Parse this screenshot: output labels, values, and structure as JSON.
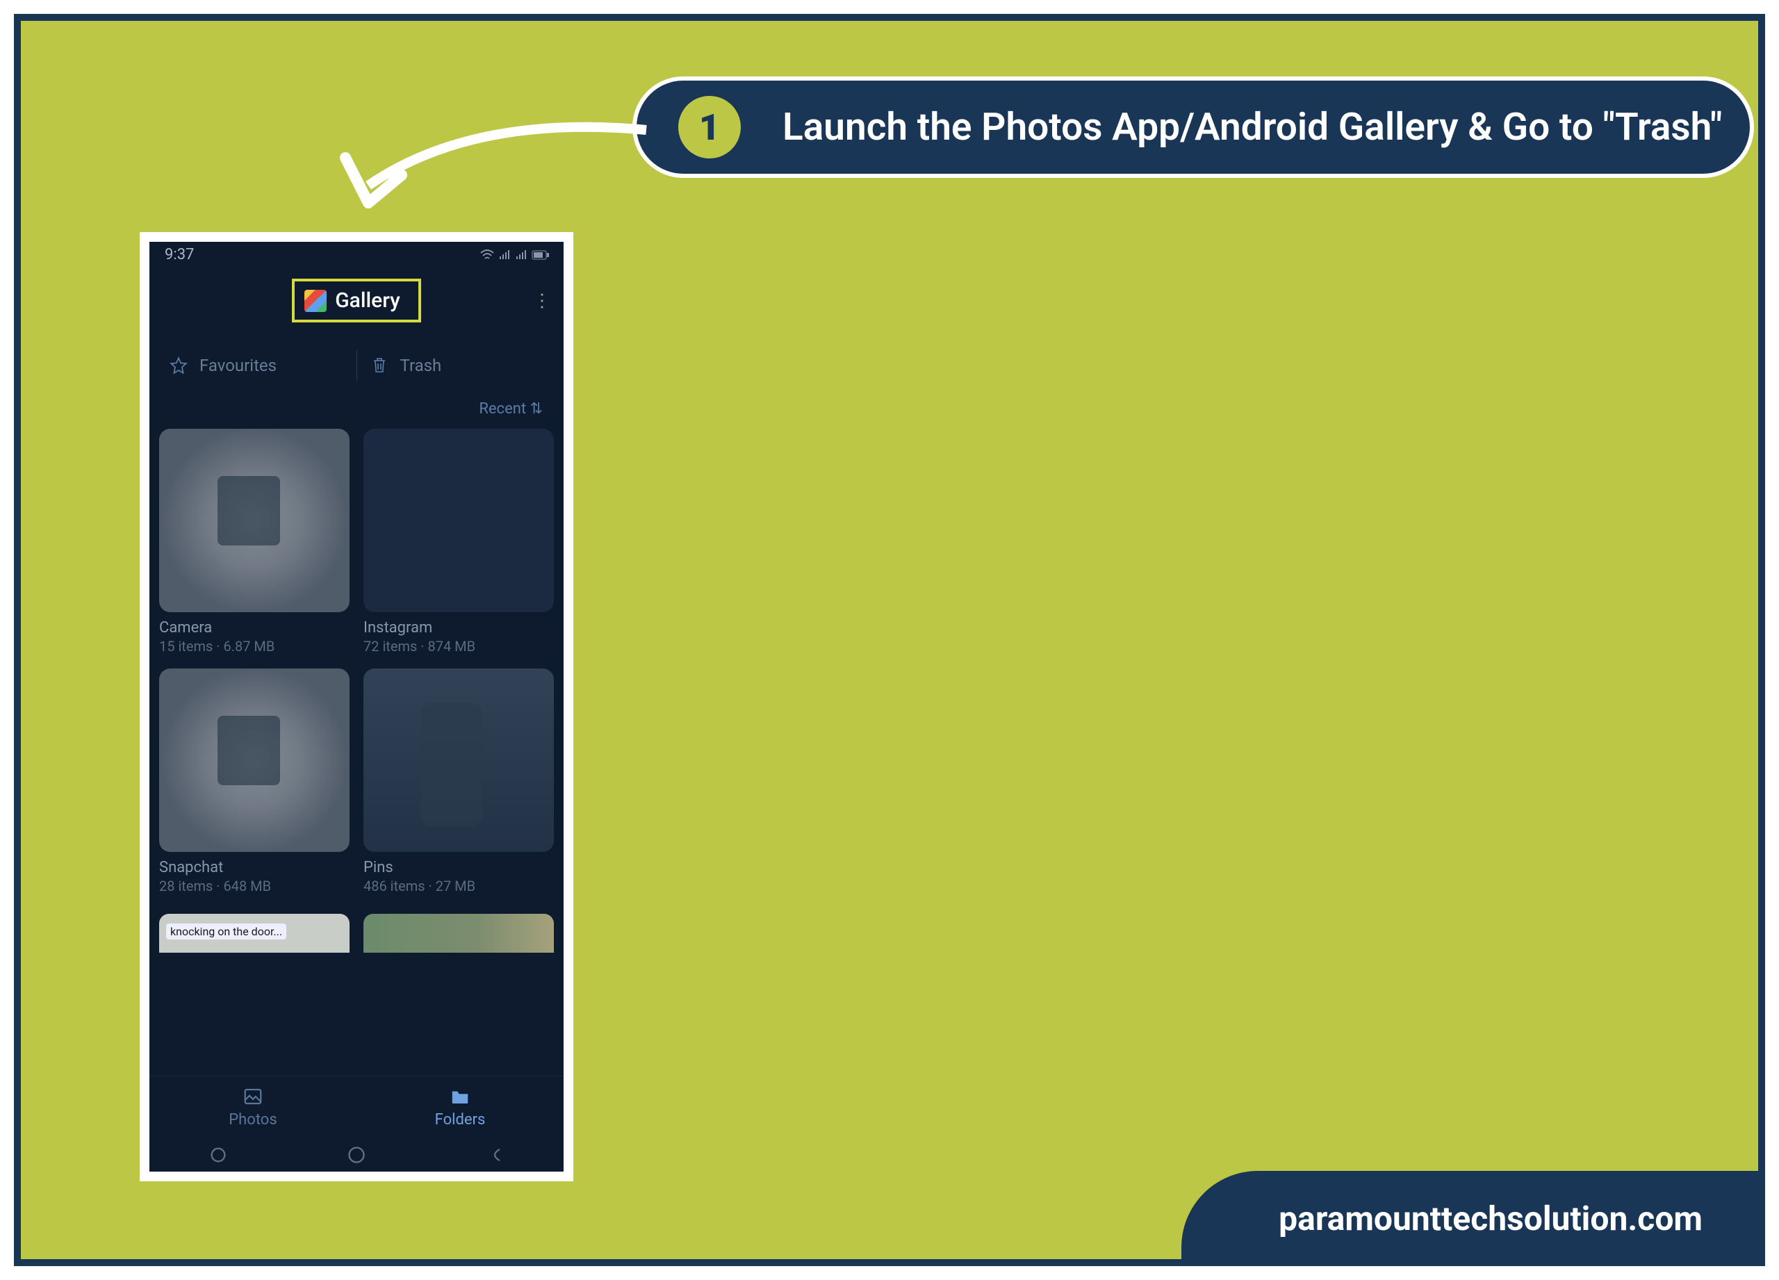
{
  "callout": {
    "step": "1",
    "text": "Launch the Photos App/Android Gallery & Go to \"Trash\""
  },
  "phone": {
    "status_time": "9:37",
    "gallery_title": "Gallery",
    "tabs": {
      "favourites": "Favourites",
      "trash": "Trash"
    },
    "sort_label": "Recent",
    "albums": [
      {
        "name": "Camera",
        "meta": "15 items · 6.87 MB"
      },
      {
        "name": "Instagram",
        "meta": "72 items · 874 MB"
      },
      {
        "name": "Snapchat",
        "meta": "28 items · 648 MB"
      },
      {
        "name": "Pins",
        "meta": "486 items · 27 MB"
      }
    ],
    "bottom_nav": {
      "photos": "Photos",
      "folders": "Folders"
    }
  },
  "footer": "paramounttechsolution.com"
}
